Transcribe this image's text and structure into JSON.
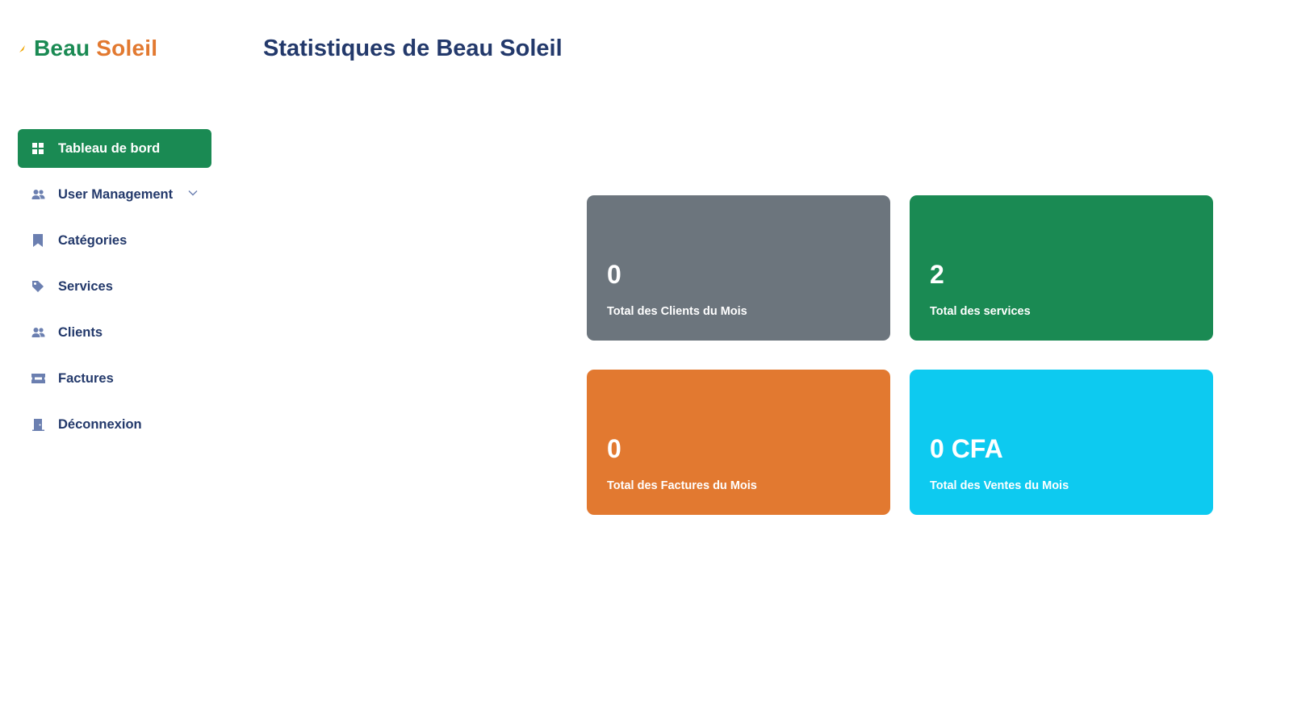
{
  "brand": {
    "word1": "Beau",
    "word2": "Soleil",
    "color_green": "#1a8a53",
    "color_orange": "#e27930"
  },
  "page_title": "Statistiques de Beau Soleil",
  "sidebar": {
    "items": [
      {
        "label": "Tableau de bord",
        "icon": "dashboard-grid-icon",
        "active": true
      },
      {
        "label": "User Management",
        "icon": "users-icon",
        "has_dropdown": true
      },
      {
        "label": "Catégories",
        "icon": "bookmark-icon"
      },
      {
        "label": "Services",
        "icon": "tag-icon"
      },
      {
        "label": "Clients",
        "icon": "users-icon"
      },
      {
        "label": "Factures",
        "icon": "ticket-icon"
      },
      {
        "label": "Déconnexion",
        "icon": "door-icon"
      }
    ],
    "active_color": "#1a8a53",
    "icon_color": "#6b7fb0"
  },
  "stats": [
    {
      "value": "0",
      "label": "Total des Clients du Mois",
      "color": "#6c757d"
    },
    {
      "value": "2",
      "label": "Total des services",
      "color": "#1a8a53"
    },
    {
      "value": "0",
      "label": "Total des Factures du Mois",
      "color": "#e27930"
    },
    {
      "value": "0 CFA",
      "label": "Total des Ventes du Mois",
      "color": "#0dcaf0"
    }
  ]
}
